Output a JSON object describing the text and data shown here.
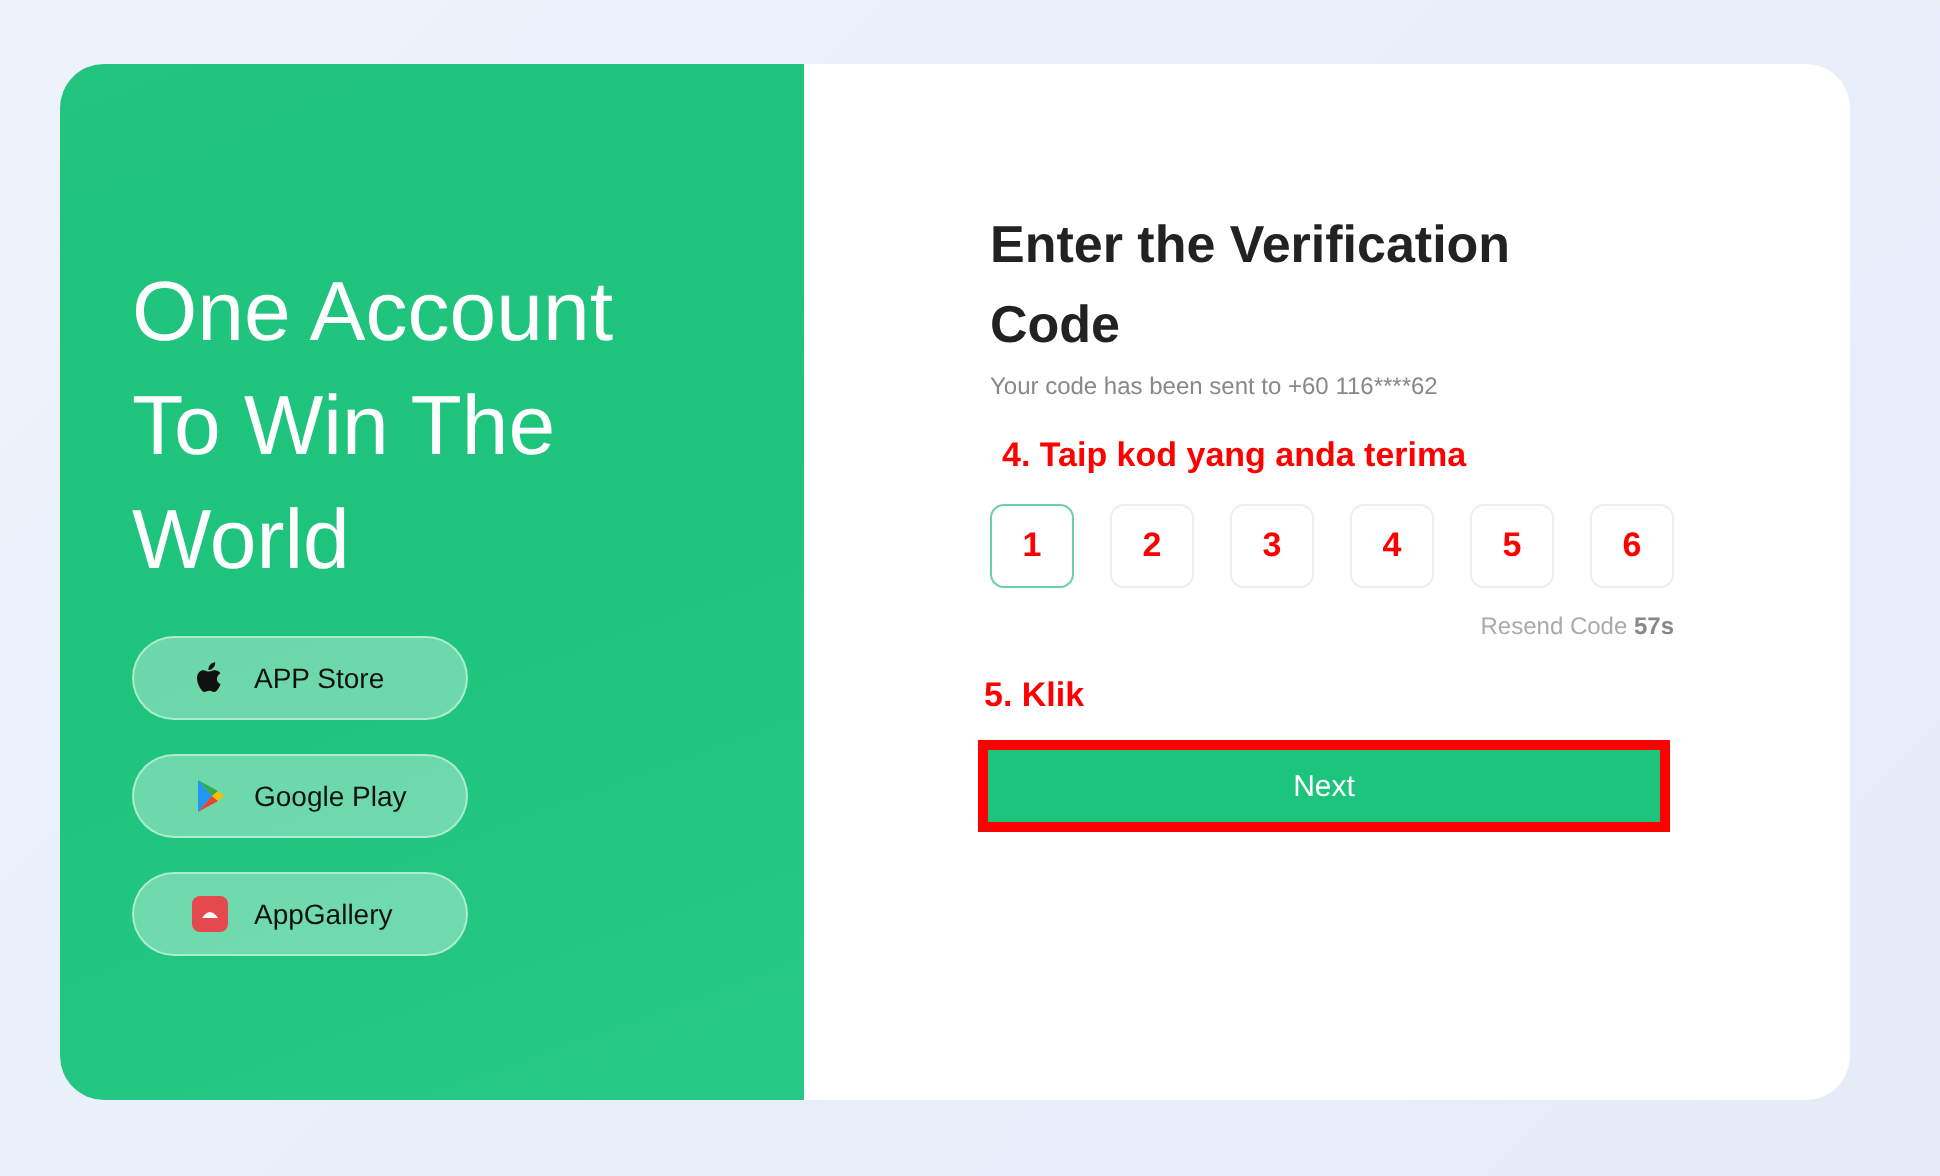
{
  "hero": {
    "headline": "One Account To Win The World"
  },
  "store_buttons": [
    {
      "kind": "apple",
      "label": "APP Store"
    },
    {
      "kind": "play",
      "label": "Google Play"
    },
    {
      "kind": "gallery",
      "label": "AppGallery"
    }
  ],
  "form": {
    "title": "Enter the Verification Code",
    "subtitle": "Your code has been sent to +60 116****62",
    "step_note": "4.  Taip kod yang anda terima",
    "code_boxes": [
      {
        "digit": "1",
        "selected": true
      },
      {
        "digit": "2",
        "selected": false
      },
      {
        "digit": "3",
        "selected": false
      },
      {
        "digit": "4",
        "selected": false
      },
      {
        "digit": "5",
        "selected": false
      },
      {
        "digit": "6",
        "selected": false
      }
    ],
    "resend": "Resend Code **57s**",
    "click_note": "5.  Klik",
    "next_button": {
      "label": "Next",
      "highlighted": true
    }
  }
}
